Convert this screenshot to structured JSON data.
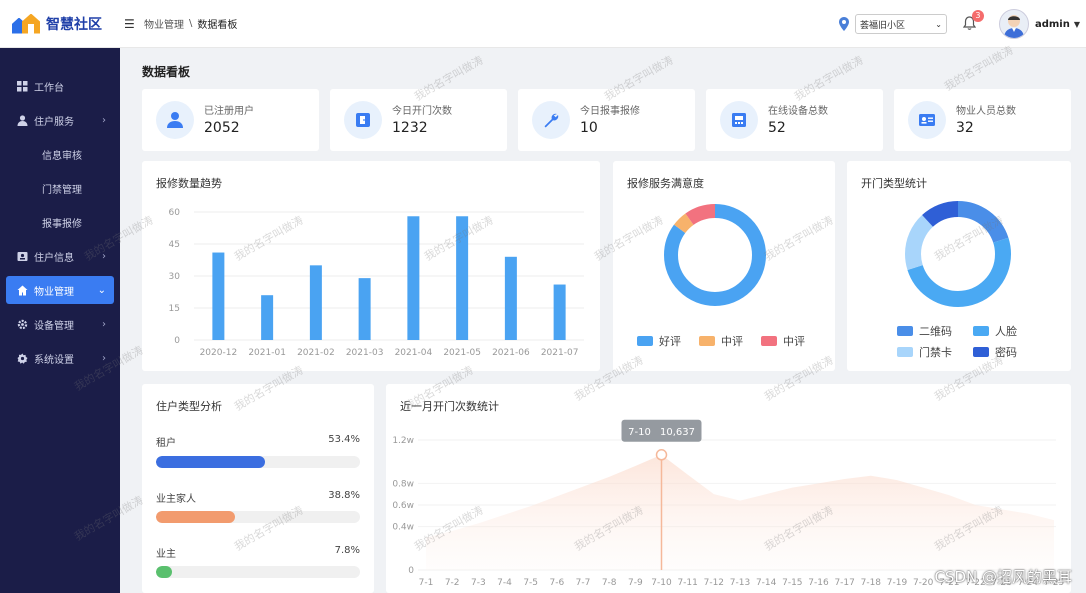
{
  "app": {
    "logo_text": "智慧社区"
  },
  "breadcrumb": {
    "parent": "物业管理",
    "sep": "\\",
    "current": "数据看板"
  },
  "header": {
    "community": "荟福旧小区",
    "notification_count": "3",
    "username": "admin"
  },
  "sidebar": {
    "items": [
      {
        "label": "工作台",
        "icon": "dashboard-icon"
      },
      {
        "label": "住户服务",
        "icon": "user-icon"
      },
      {
        "label": "信息审核"
      },
      {
        "label": "门禁管理"
      },
      {
        "label": "报事报修"
      },
      {
        "label": "住户信息",
        "icon": "id-card-icon"
      },
      {
        "label": "物业管理",
        "icon": "home-icon"
      },
      {
        "label": "设备管理",
        "icon": "gear-icon"
      },
      {
        "label": "系统设置",
        "icon": "settings-icon"
      }
    ]
  },
  "page_title": "数据看板",
  "stats": [
    {
      "label": "已注册用户",
      "value": "2052",
      "icon": "user-icon"
    },
    {
      "label": "今日开门次数",
      "value": "1232",
      "icon": "door-icon"
    },
    {
      "label": "今日报事报修",
      "value": "10",
      "icon": "wrench-icon"
    },
    {
      "label": "在线设备总数",
      "value": "52",
      "icon": "device-icon"
    },
    {
      "label": "物业人员总数",
      "value": "32",
      "icon": "staff-card-icon"
    }
  ],
  "panels": {
    "repair_trend": "报修数量趋势",
    "satisfaction": "报修服务满意度",
    "door_types": "开门类型统计",
    "resident_types": "住户类型分析",
    "monthly_opens": "近一月开门次数统计"
  },
  "colors": {
    "accent": "#3a7cf2",
    "sidebar_bg": "#1b1d48",
    "bar": "#4aa3f2"
  },
  "chart_data": [
    {
      "type": "bar",
      "title": "报修数量趋势",
      "categories": [
        "2020-12",
        "2021-01",
        "2021-02",
        "2021-03",
        "2021-04",
        "2021-05",
        "2021-06",
        "2021-07"
      ],
      "values": [
        41,
        21,
        35,
        29,
        58,
        58,
        39,
        26
      ],
      "ylim": [
        0,
        60
      ],
      "yticks": [
        0,
        15,
        30,
        45,
        60
      ],
      "grid": true
    },
    {
      "type": "pie",
      "title": "报修服务满意度",
      "labels": [
        "好评",
        "中评",
        "中评"
      ],
      "values": [
        85,
        5,
        10
      ],
      "colors": [
        "#4aa3f2",
        "#f7b26b",
        "#f2727f"
      ],
      "legend": "bottom"
    },
    {
      "type": "pie",
      "title": "开门类型统计",
      "labels": [
        "二维码",
        "人脸",
        "门禁卡",
        "密码"
      ],
      "values": [
        20,
        50,
        18,
        12
      ],
      "colors": [
        "#4a8ee8",
        "#4aa9f3",
        "#a8d5fb",
        "#2f5fd6"
      ],
      "legend": "bottom"
    },
    {
      "type": "area",
      "title": "近一月开门次数统计",
      "x": [
        "7-1",
        "7-2",
        "7-3",
        "7-4",
        "7-5",
        "7-6",
        "7-7",
        "7-8",
        "7-9",
        "7-10",
        "7-11",
        "7-12",
        "7-13",
        "7-14",
        "7-15",
        "7-16",
        "7-17",
        "7-18",
        "7-19",
        "7-20",
        "7-21",
        "7-22",
        "7-23",
        "7-24",
        "7-25"
      ],
      "values": [
        3000,
        3600,
        4300,
        5100,
        5900,
        6800,
        7700,
        8600,
        9600,
        10637,
        8800,
        7000,
        6400,
        7000,
        7600,
        8000,
        8400,
        8700,
        8300,
        7600,
        6900,
        6000,
        5600,
        5200,
        4600
      ],
      "ylim": [
        0,
        12000
      ],
      "yticks": [
        "0",
        "0.4w",
        "0.6w",
        "0.8w",
        "1.2w"
      ],
      "tooltip": {
        "x": "7-10",
        "value": "10,637"
      }
    },
    {
      "type": "bar",
      "title": "住户类型分析",
      "categories": [
        "租户",
        "业主家人",
        "业主"
      ],
      "values": [
        53.4,
        38.8,
        7.8
      ],
      "labels": [
        "53.4%",
        "38.8%",
        "7.8%"
      ],
      "colors": [
        "#3b6ee0",
        "#f29b6e",
        "#5ac06e"
      ]
    }
  ],
  "watermark": "我的名字叫做涛",
  "footer_watermark": "CSDN @招风的黑耳"
}
